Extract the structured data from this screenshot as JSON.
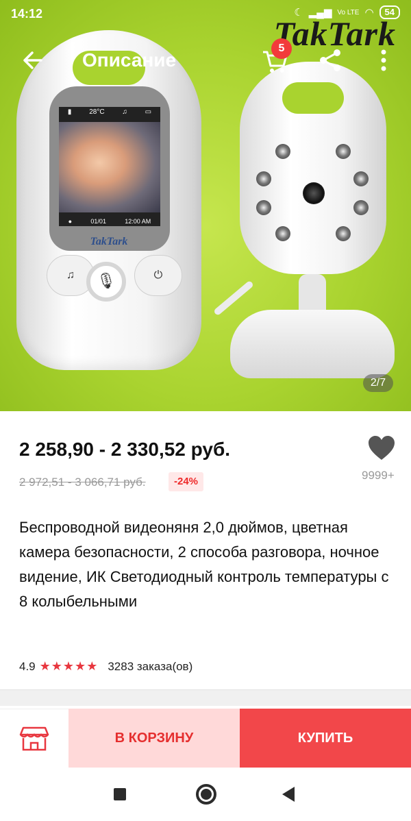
{
  "status_bar": {
    "time": "14:12",
    "network": "Vo LTE",
    "battery": "54"
  },
  "image": {
    "brand_watermark": "TakTark",
    "monitor_brand": "TakTark",
    "screen_temp": "28°C",
    "screen_page": "01/01",
    "screen_time": "12:00 AM",
    "counter": "2/7"
  },
  "topbar": {
    "title": "Описание",
    "cart_count": "5"
  },
  "product": {
    "price": "2 258,90 - 2 330,52 руб.",
    "old_price": "2 972,51 - 3 066,71 руб.",
    "discount": "-24%",
    "wishlist_count": "9999+",
    "title": "Беспроводной видеоняня 2,0 дюймов, цветная камера безопасности, 2 способа разговора, ночное видение, ИК Светодиодный контроль температуры с 8 колыбельными",
    "rating": "4.9",
    "stars": "★★★★★",
    "orders": "3283 заказа(ов)"
  },
  "actions": {
    "add_to_cart": "В КОРЗИНУ",
    "buy": "КУПИТЬ"
  },
  "colors": {
    "accent": "#f2474a",
    "accent_light": "#ffd9d9",
    "discount_text": "#ee2a2a",
    "star": "#e8373f"
  }
}
